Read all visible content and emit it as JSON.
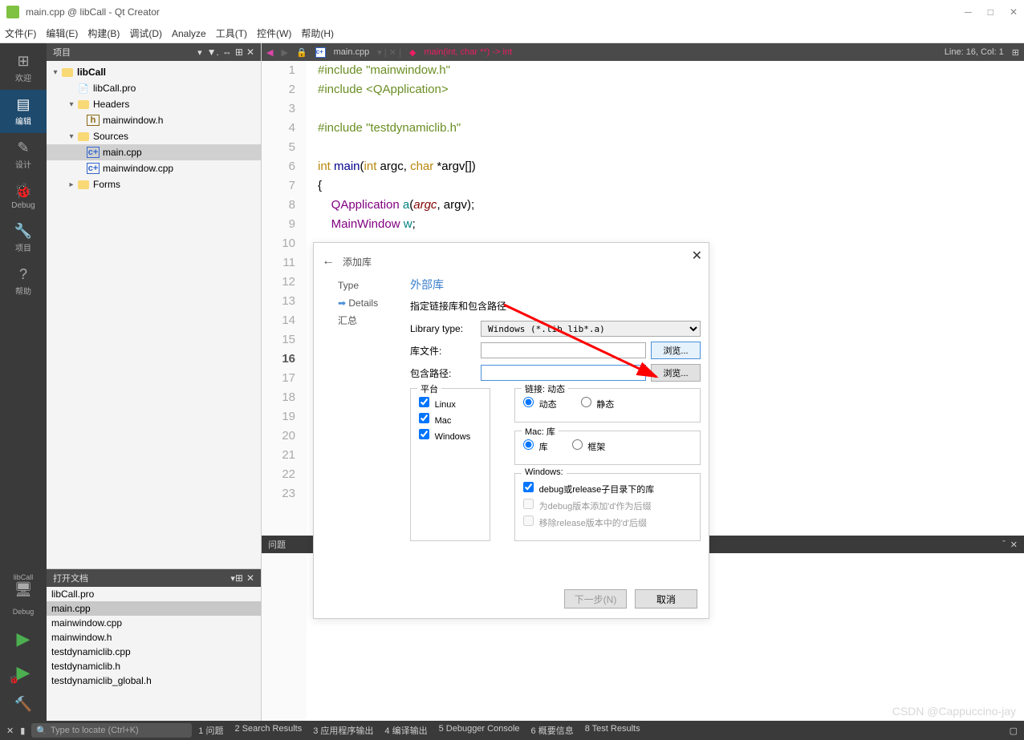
{
  "window": {
    "title": "main.cpp @ libCall - Qt Creator"
  },
  "menu": [
    "文件(F)",
    "编辑(E)",
    "构建(B)",
    "调试(D)",
    "Analyze",
    "工具(T)",
    "控件(W)",
    "帮助(H)"
  ],
  "leftbar": {
    "items": [
      "欢迎",
      "编辑",
      "设计",
      "Debug",
      "项目",
      "帮助"
    ],
    "project": "libCall",
    "kit": "Debug"
  },
  "project_panel": {
    "title": "项目",
    "root": "libCall",
    "pro": "libCall.pro",
    "headers": {
      "label": "Headers",
      "files": [
        "mainwindow.h"
      ]
    },
    "sources": {
      "label": "Sources",
      "files": [
        "main.cpp",
        "mainwindow.cpp"
      ]
    },
    "forms": "Forms"
  },
  "open_docs": {
    "title": "打开文档",
    "files": [
      "libCall.pro",
      "main.cpp",
      "mainwindow.cpp",
      "mainwindow.h",
      "testdynamiclib.cpp",
      "testdynamiclib.h",
      "testdynamiclib_global.h"
    ],
    "selected": "main.cpp"
  },
  "editor": {
    "tab_file": "main.cpp",
    "crumb_func": "main(int, char **) -> int",
    "position": "Line: 16, Col: 1",
    "lines": [
      {
        "n": 1,
        "html": "<span class='kw-green'>#include</span> <span class='kw-green'>\"mainwindow.h\"</span>"
      },
      {
        "n": 2,
        "html": "<span class='kw-green'>#include</span> <span class='kw-green'>&lt;QApplication&gt;</span>"
      },
      {
        "n": 3,
        "html": ""
      },
      {
        "n": 4,
        "html": "<span class='kw-green'>#include</span> <span class='kw-green'>\"testdynamiclib.h\"</span>"
      },
      {
        "n": 5,
        "html": ""
      },
      {
        "n": 6,
        "html": "<span class='kw-yellow'>int</span> <span class='kw-blue'>main</span>(<span class='kw-yellow'>int</span> argc, <span class='kw-yellow'>char</span> *argv[])"
      },
      {
        "n": 7,
        "html": "{"
      },
      {
        "n": 8,
        "html": "    <span class='kw-purple'>QApplication</span> <span class='kw-teal'>a</span>(<span class='kw-red'>argc</span>, argv);"
      },
      {
        "n": 9,
        "html": "    <span class='kw-purple'>MainWindow</span> <span class='kw-teal'>w</span>;"
      },
      {
        "n": 10,
        "html": ""
      },
      {
        "n": 11,
        "html": ""
      },
      {
        "n": 12,
        "html": ""
      },
      {
        "n": 13,
        "html": ""
      },
      {
        "n": 14,
        "html": ""
      },
      {
        "n": 15,
        "html": ""
      },
      {
        "n": 16,
        "html": ""
      },
      {
        "n": 17,
        "html": ""
      },
      {
        "n": 18,
        "html": ""
      },
      {
        "n": 19,
        "html": ""
      },
      {
        "n": 20,
        "html": ""
      },
      {
        "n": 21,
        "html": ""
      },
      {
        "n": 22,
        "html": ""
      },
      {
        "n": 23,
        "html": ""
      }
    ],
    "current_line": 16
  },
  "dialog": {
    "title": "添加库",
    "steps": {
      "type": "Type",
      "details": "Details",
      "summary": "汇总"
    },
    "heading": "外部库",
    "subtitle": "指定链接库和包含路径",
    "lib_type_label": "Library type:",
    "lib_type_value": "Windows (*.lib lib*.a)",
    "lib_file_label": "库文件:",
    "include_label": "包含路径:",
    "browse": "浏览...",
    "platform_label": "平台",
    "platforms": [
      "Linux",
      "Mac",
      "Windows"
    ],
    "link_label": "链接: 动态",
    "link_dynamic": "动态",
    "link_static": "静态",
    "mac_label": "Mac: 库",
    "mac_lib": "库",
    "mac_framework": "框架",
    "windows_label": "Windows:",
    "win_opt1": "debug或release子目录下的库",
    "win_opt2": "为debug版本添加'd'作为后缀",
    "win_opt3": "移除release版本中的'd'后缀",
    "next": "下一步(N)",
    "cancel": "取消"
  },
  "problems_bar": "问题",
  "statusbar": {
    "locate_placeholder": "Type to locate (Ctrl+K)",
    "tabs": [
      "1 问题",
      "2 Search Results",
      "3 应用程序输出",
      "4 编译输出",
      "5 Debugger Console",
      "6 概要信息",
      "8 Test Results"
    ]
  },
  "watermark": "CSDN @Cappuccino-jay"
}
